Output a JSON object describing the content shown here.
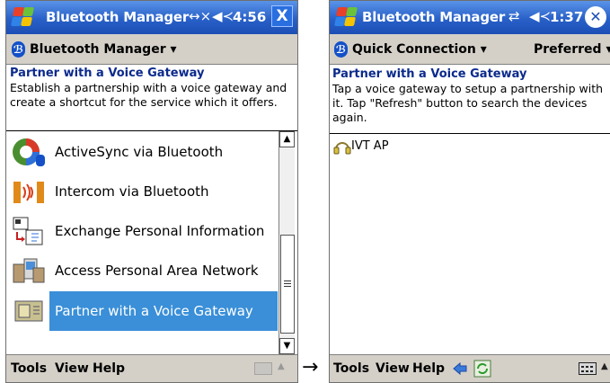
{
  "left_screen": {
    "title": "Bluetooth Manager",
    "time": "4:56",
    "close_label": "X",
    "menu_title": "Bluetooth Manager",
    "header_title": "Partner with a Voice Gateway",
    "header_desc": "Establish a partnership with a voice gateway and create a shortcut for the service which it offers.",
    "items": [
      {
        "label": "ActiveSync via Bluetooth",
        "icon": "activesync-icon"
      },
      {
        "label": "Intercom via Bluetooth",
        "icon": "intercom-icon"
      },
      {
        "label": "Exchange Personal Information",
        "icon": "exchange-icon"
      },
      {
        "label": "Access Personal Area Network",
        "icon": "pan-icon"
      },
      {
        "label": "Partner with a Voice Gateway",
        "icon": "voice-gateway-icon",
        "selected": true
      }
    ],
    "bottom_menu": [
      "Tools",
      "View",
      "Help"
    ]
  },
  "right_screen": {
    "title": "Bluetooth Manager",
    "time": "1:37",
    "close_label": "✕",
    "menu_left": "Quick Connection",
    "menu_right": "Preferred",
    "header_title": "Partner with a Voice Gateway",
    "header_desc": "Tap a voice gateway to setup a partnership with it. Tap \"Refresh\" button to search the devices again.",
    "devices": [
      {
        "label": "IVT AP",
        "icon": "headset-icon"
      }
    ],
    "bottom_menu": [
      "Tools",
      "View",
      "Help"
    ]
  },
  "arrow": "→",
  "colors": {
    "title_bar": "#2860c8",
    "selection": "#3a8fd8",
    "header_title": "#0b2a8c",
    "bar_gray": "#d4d0c8"
  }
}
